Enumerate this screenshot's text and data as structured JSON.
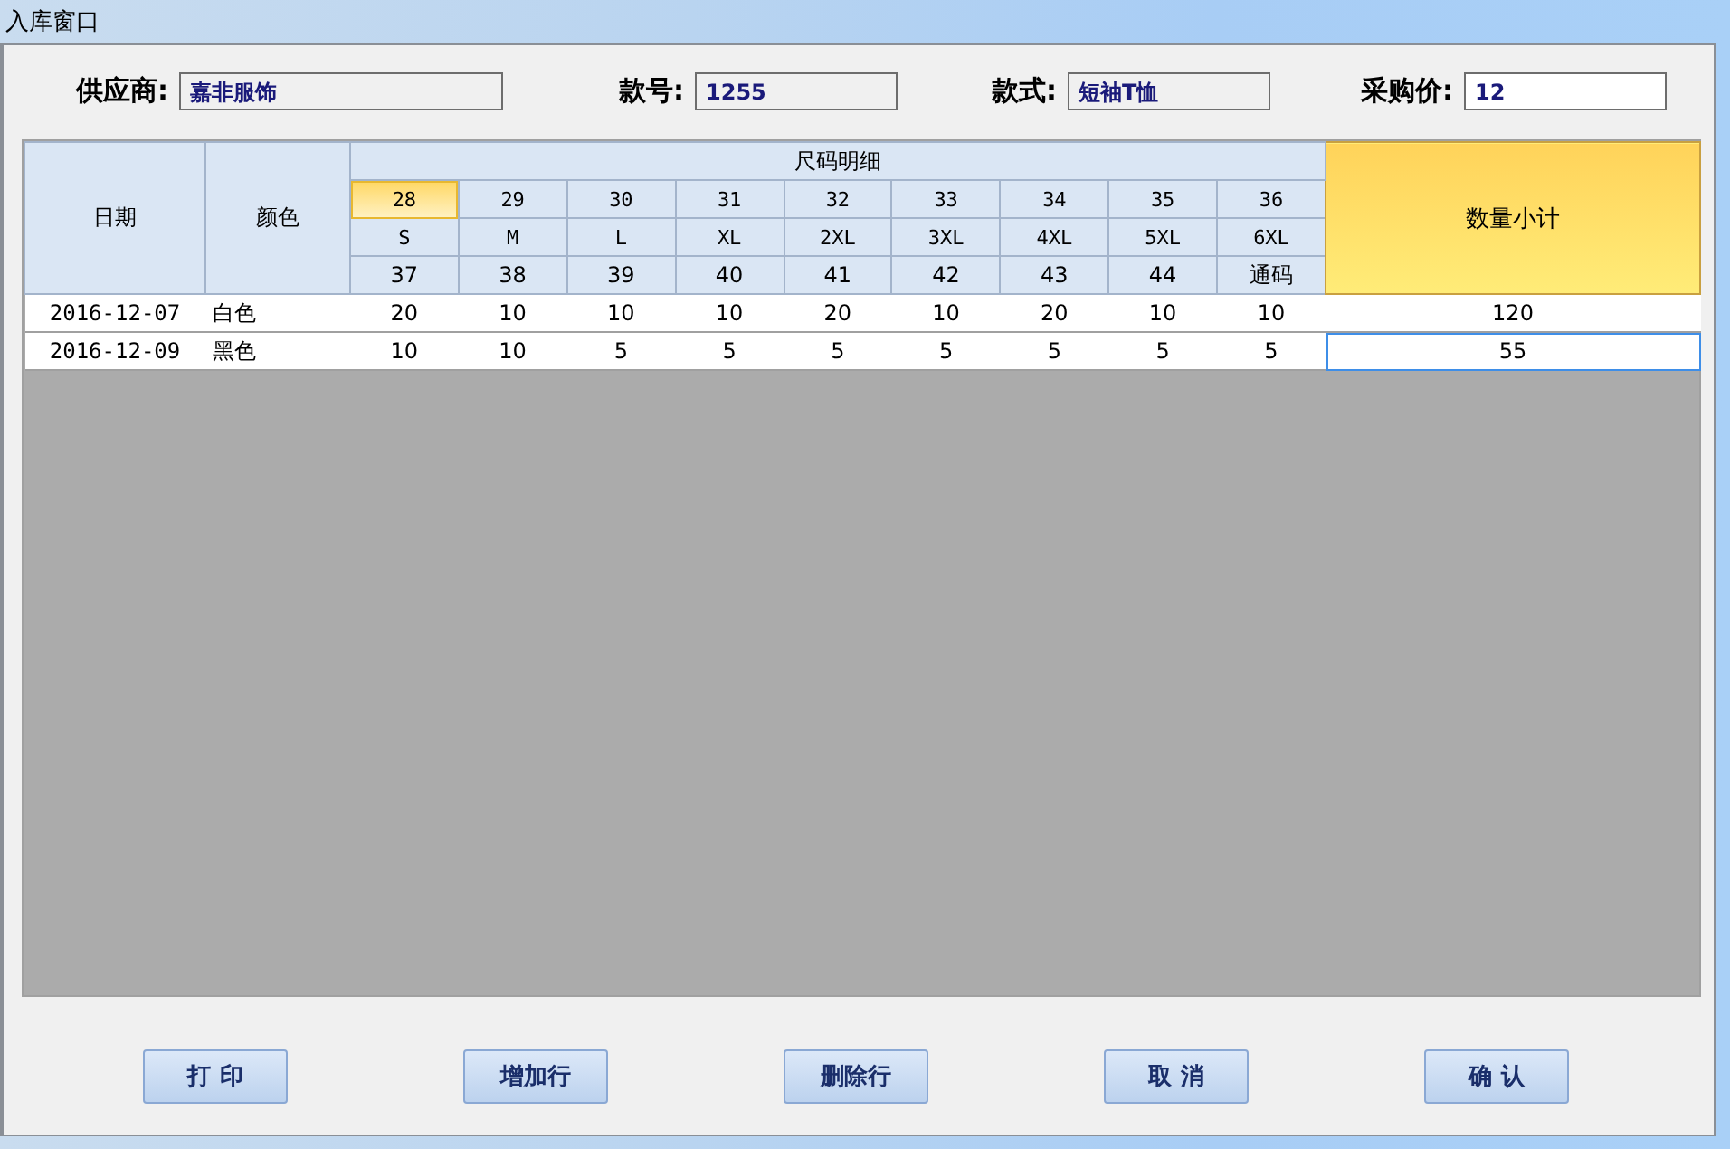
{
  "window": {
    "title": "入库窗口"
  },
  "fields": [
    {
      "label": "供应商:",
      "value": "嘉非服饰",
      "editable": false
    },
    {
      "label": "款号:",
      "value": "1255",
      "editable": false
    },
    {
      "label": "款式:",
      "value": "短袖T恤",
      "editable": false
    },
    {
      "label": "采购价:",
      "value": "12",
      "editable": true
    }
  ],
  "grid": {
    "columns": {
      "date": "日期",
      "color_name": "颜色",
      "sizes_group": "尺码明细",
      "subtotal": "数量小计"
    },
    "size_columns": [
      {
        "number": "28",
        "letter": "S",
        "eu": "37",
        "selected": true
      },
      {
        "number": "29",
        "letter": "M",
        "eu": "38",
        "selected": false
      },
      {
        "number": "30",
        "letter": "L",
        "eu": "39",
        "selected": false
      },
      {
        "number": "31",
        "letter": "XL",
        "eu": "40",
        "selected": false
      },
      {
        "number": "32",
        "letter": "2XL",
        "eu": "41",
        "selected": false
      },
      {
        "number": "33",
        "letter": "3XL",
        "eu": "42",
        "selected": false
      },
      {
        "number": "34",
        "letter": "4XL",
        "eu": "43",
        "selected": false
      },
      {
        "number": "35",
        "letter": "5XL",
        "eu": "44",
        "selected": false
      },
      {
        "number": "36",
        "letter": "6XL",
        "eu": "通码",
        "selected": false
      }
    ],
    "rows": [
      {
        "date": "2016-12-07",
        "color_name": "白色",
        "sizes": [
          "20",
          "10",
          "10",
          "10",
          "20",
          "10",
          "20",
          "10",
          "10"
        ],
        "subtotal": "120",
        "subtotal_selected": false
      },
      {
        "date": "2016-12-09",
        "color_name": "黑色",
        "sizes": [
          "10",
          "10",
          "5",
          "5",
          "5",
          "5",
          "5",
          "5",
          "5"
        ],
        "subtotal": "55",
        "subtotal_selected": true
      }
    ]
  },
  "buttons": [
    "打 印",
    "增加行",
    "删除行",
    "取 消",
    "确 认"
  ]
}
